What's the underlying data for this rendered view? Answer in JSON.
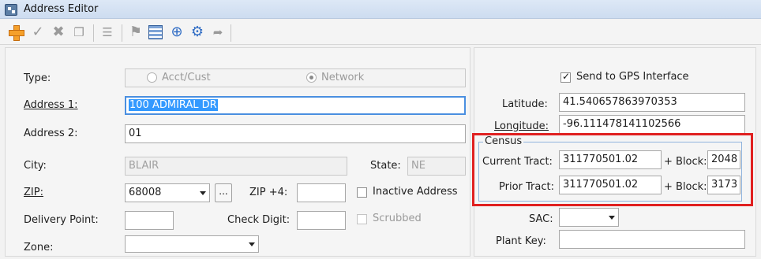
{
  "window": {
    "title": "Address Editor"
  },
  "toolbar": {
    "icons": [
      "add-icon",
      "approve-icon",
      "delete-icon",
      "copy-icon",
      "list-icon",
      "map-pin-icon",
      "grid-icon",
      "plus-circle-icon",
      "route-icon",
      "export-icon"
    ]
  },
  "form": {
    "type": {
      "label": "Type:",
      "option_acct": "Acct/Cust",
      "option_network": "Network",
      "selected": "Network"
    },
    "address1": {
      "label": "Address 1:",
      "value": "100 ADMIRAL DR"
    },
    "address2": {
      "label": "Address 2:",
      "value": "01"
    },
    "city": {
      "label": "City:",
      "value": "BLAIR"
    },
    "state": {
      "label": "State:",
      "value": "NE"
    },
    "zip": {
      "label": "ZIP:",
      "value": "68008",
      "lookup_label": "...",
      "zip4_label": "ZIP +4:",
      "zip4_value": ""
    },
    "inactive_address": {
      "label": "Inactive Address",
      "checked": false
    },
    "delivery_point": {
      "label": "Delivery Point:",
      "value": ""
    },
    "check_digit": {
      "label": "Check Digit:",
      "value": ""
    },
    "scrubbed": {
      "label": "Scrubbed",
      "checked": false
    },
    "zone": {
      "label": "Zone:",
      "value": ""
    }
  },
  "right": {
    "send_gps": {
      "label": "Send to GPS Interface",
      "checked": true
    },
    "latitude": {
      "label": "Latitude:",
      "value": "41.540657863970353"
    },
    "longitude": {
      "label": "Longitude:",
      "value": "-96.111478141102566"
    },
    "census": {
      "legend": "Census",
      "current_tract_label": "Current Tract:",
      "current_tract_value": "311770501.02",
      "current_block_label": "+ Block:",
      "current_block_value": "2048",
      "prior_tract_label": "Prior Tract:",
      "prior_tract_value": "311770501.02",
      "prior_block_label": "+ Block:",
      "prior_block_value": "3173"
    },
    "sac": {
      "label": "SAC:",
      "value": ""
    },
    "plant_key": {
      "label": "Plant Key:",
      "value": ""
    }
  },
  "colors": {
    "highlight": "#e02020",
    "focus": "#4a8fe0",
    "selection": "#3399ff"
  }
}
